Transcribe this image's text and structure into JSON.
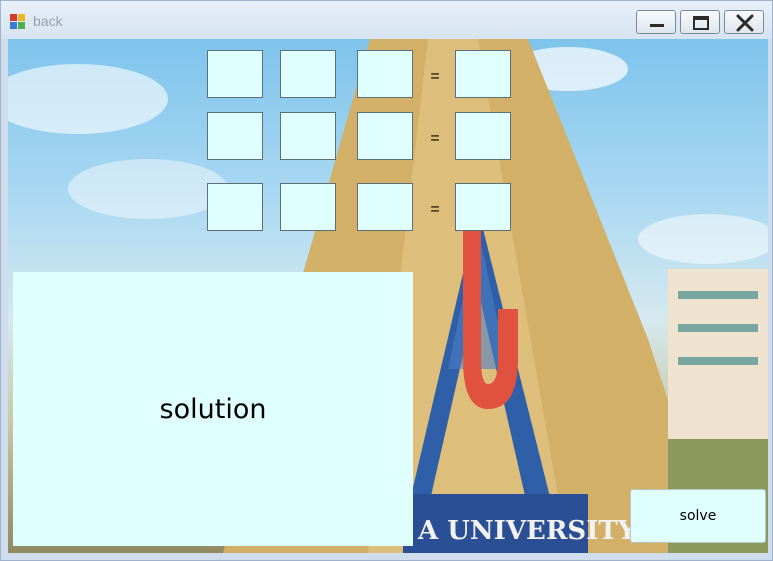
{
  "window": {
    "title": "back",
    "icon": "app-icon",
    "controls": [
      "minimize-icon",
      "maximize-icon",
      "close-icon"
    ]
  },
  "equations": [
    {
      "coefficients": [
        "",
        "",
        ""
      ],
      "equals": "=",
      "result": ""
    },
    {
      "coefficients": [
        "",
        "",
        ""
      ],
      "equals": "=",
      "result": ""
    },
    {
      "coefficients": [
        "",
        "",
        ""
      ],
      "equals": "=",
      "result": ""
    }
  ],
  "solution_label": "solution",
  "solve_label": "solve",
  "background": {
    "sign_text": "A UNIVERSITY",
    "colors": {
      "sky": "#8fcdf0",
      "gold": "#d9b66a",
      "blue": "#2f5fa8",
      "red": "#e0523f",
      "field": "#e0ffff"
    }
  }
}
